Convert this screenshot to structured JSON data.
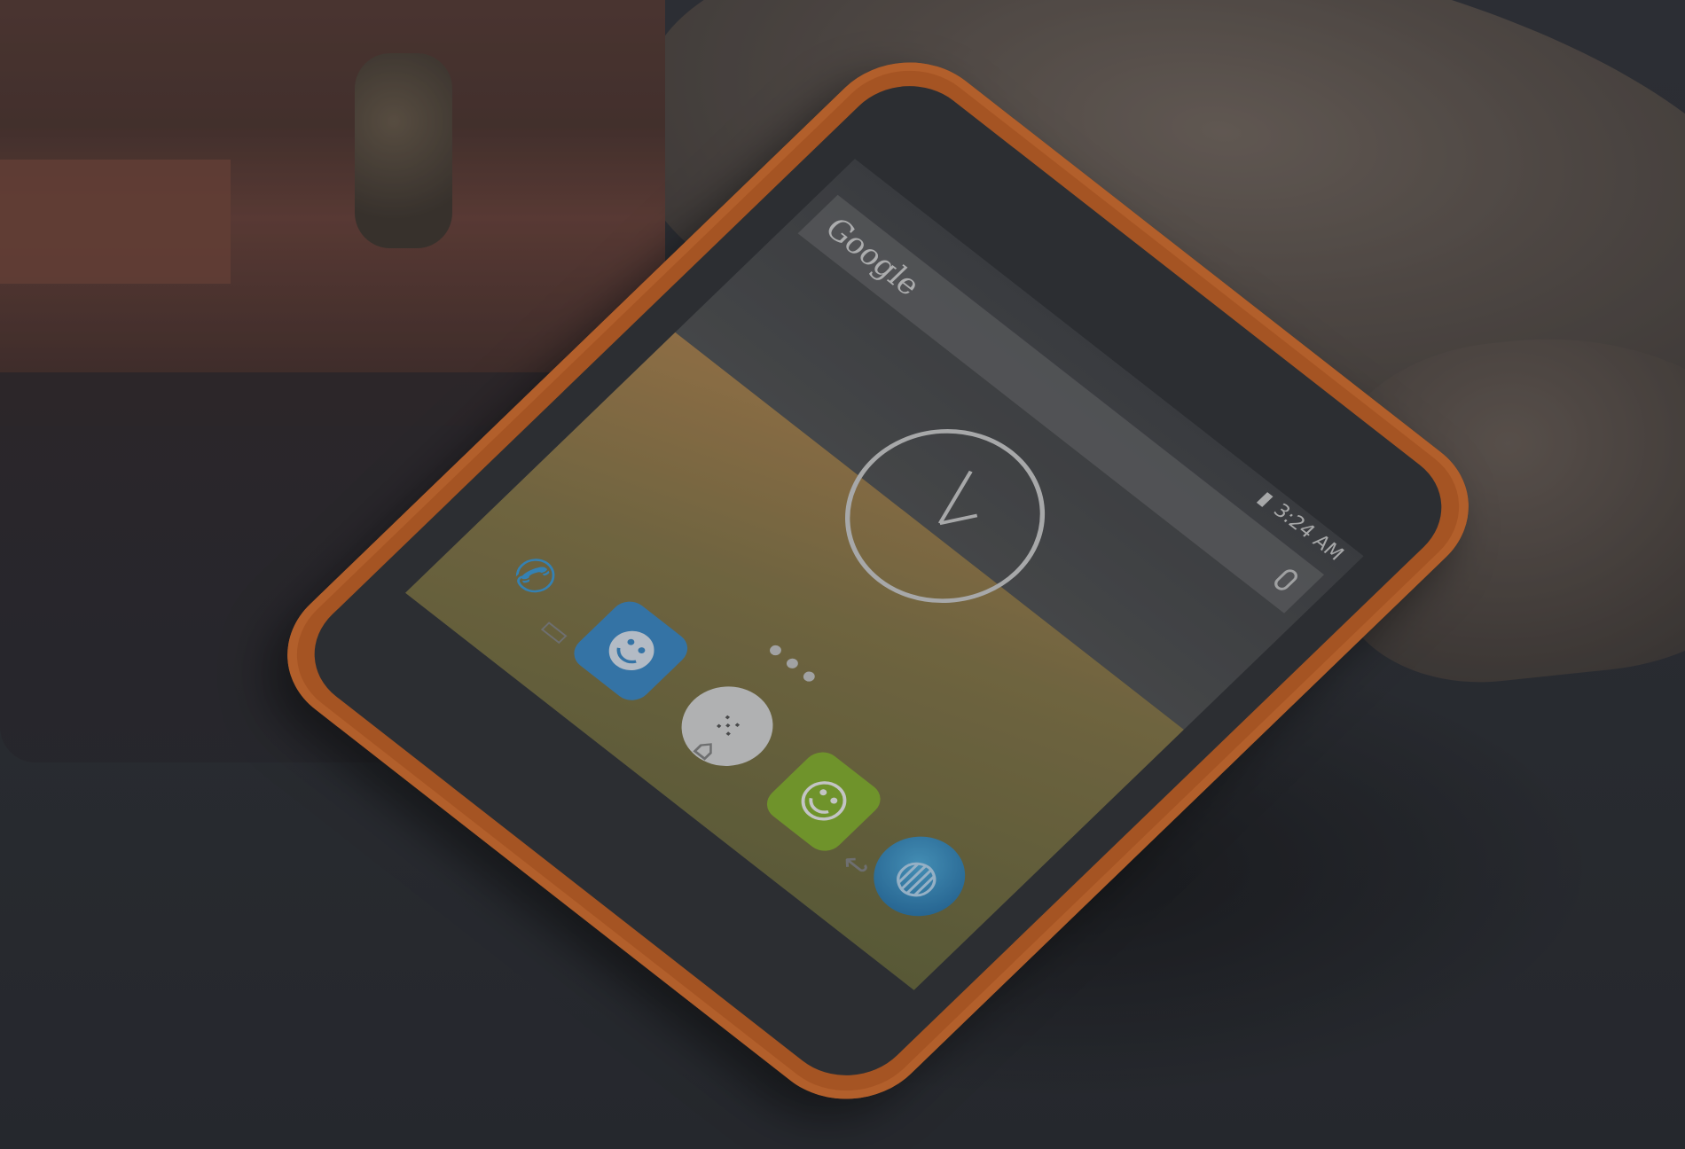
{
  "photo": {
    "subject": "smartphone",
    "accent_color": "#d6641f"
  },
  "phone_screen": {
    "search_logo": "Google",
    "status_time": "3:24 AM",
    "icons": {
      "phone": "phone-icon",
      "contacts": "contacts-icon",
      "app_drawer": "app-drawer-icon",
      "messaging": "messaging-icon",
      "browser": "browser-icon",
      "mic": "mic-icon"
    }
  }
}
